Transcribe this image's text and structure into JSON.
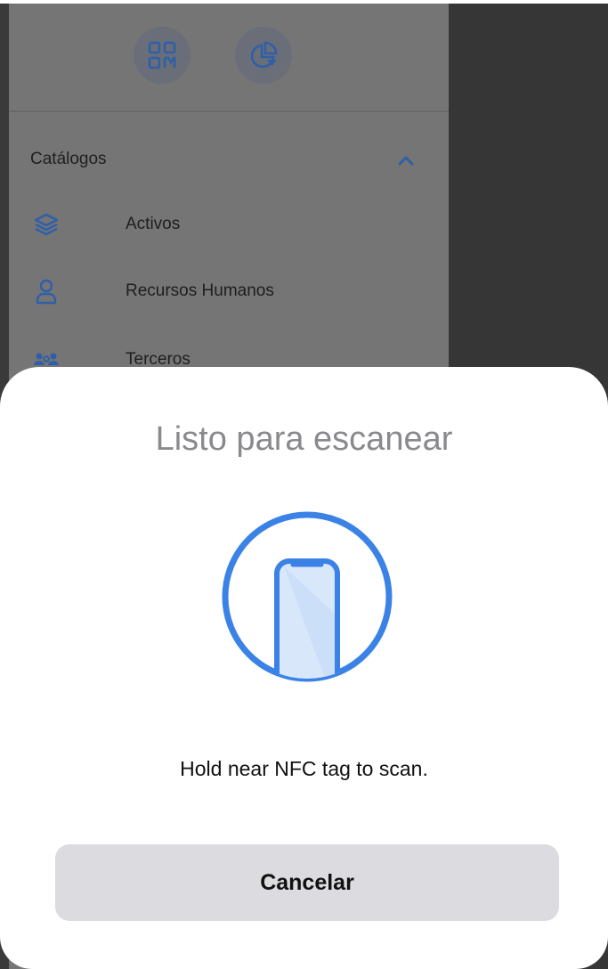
{
  "drawer": {
    "quick_actions": [
      {
        "icon": "qr-code-icon"
      },
      {
        "icon": "pie-chart-icon"
      }
    ],
    "section": {
      "title": "Catálogos",
      "expanded": true,
      "items": [
        {
          "label": "Activos",
          "icon": "layers-icon"
        },
        {
          "label": "Recursos Humanos",
          "icon": "person-icon"
        },
        {
          "label": "Terceros",
          "icon": "people-icon"
        }
      ]
    }
  },
  "nfc_sheet": {
    "title": "Listo para escanear",
    "hint": "Hold near NFC tag to scan.",
    "cancel_label": "Cancelar",
    "accent_color": "#3b82e6"
  }
}
